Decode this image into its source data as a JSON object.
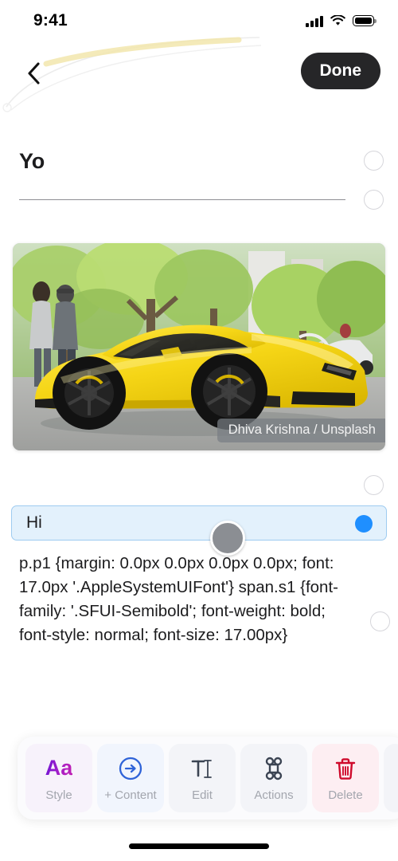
{
  "status_bar": {
    "time": "9:41",
    "cellular_icon": "cellular-bars-icon",
    "wifi_icon": "wifi-icon",
    "battery_icon": "battery-full-icon"
  },
  "nav": {
    "back_icon": "chevron-left-icon",
    "done_label": "Done"
  },
  "blocks": {
    "heading": {
      "text": "Yo",
      "bullet": "unselected"
    },
    "divider": {
      "bullet": "unselected"
    },
    "image": {
      "alt": "Yellow Lamborghini Huracan parked on a street with green trees",
      "credit": "Dhiva Krishna / Unsplash",
      "bullet": "unselected"
    },
    "selected_text": {
      "text": "Hi",
      "bullet": "selected"
    },
    "code": {
      "text": "p.p1 {margin: 0.0px 0.0px 0.0px 0.0px; font: 17.0px '.AppleSystemUIFont'} span.s1 {font-family: '.SFUI-Semibold'; font-weight: bold; font-style: normal; font-size: 17.00px}",
      "bullet": "unselected"
    }
  },
  "toolbar": {
    "items": [
      {
        "label": "Style",
        "icon": "aa-text-style-icon",
        "glyph": "Aa"
      },
      {
        "label": "+ Content",
        "icon": "circled-arrow-right-icon"
      },
      {
        "label": "Edit",
        "icon": "text-cursor-icon"
      },
      {
        "label": "Actions",
        "icon": "command-key-icon"
      },
      {
        "label": "Delete",
        "icon": "trash-icon"
      }
    ]
  },
  "colors": {
    "accent_blue": "#1f8fff",
    "selection_bg": "#e3f1fc",
    "selection_border": "#9ecbf0",
    "delete_red": "#cf0a2c",
    "style_purple": "#8f1ecb",
    "done_bg": "#262628"
  },
  "home_indicator": "home-bar"
}
